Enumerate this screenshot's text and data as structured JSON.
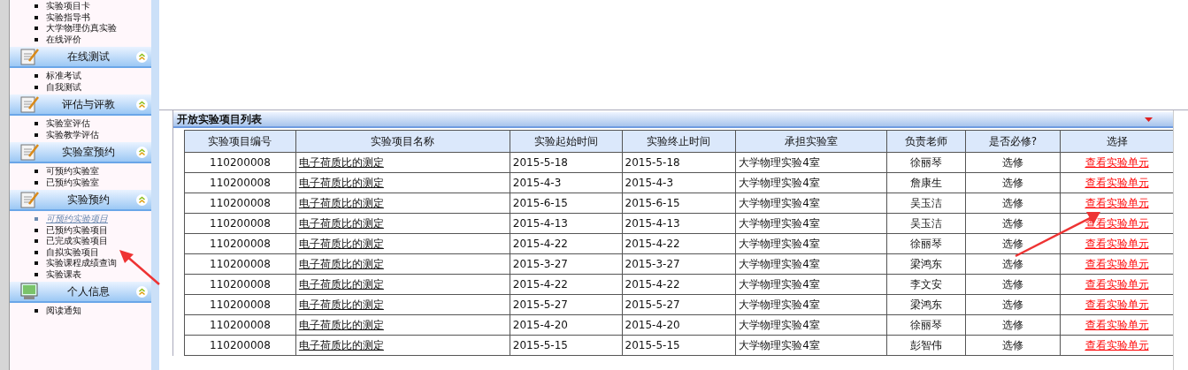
{
  "sidebar": {
    "sections": [
      {
        "items": [
          {
            "label": "实验项目卡",
            "selected": false
          },
          {
            "label": "实验指导书",
            "selected": false
          },
          {
            "label": "大学物理仿真实验",
            "selected": false
          },
          {
            "label": "在线评价",
            "selected": false
          }
        ]
      },
      {
        "title": "在线测试",
        "kind": "notepad",
        "items": [
          {
            "label": "标准考试",
            "selected": false
          },
          {
            "label": "自我测试",
            "selected": false
          }
        ]
      },
      {
        "title": "评估与评教",
        "kind": "notepad",
        "items": [
          {
            "label": "实验室评估",
            "selected": false
          },
          {
            "label": "实验教学评估",
            "selected": false
          }
        ]
      },
      {
        "title": "实验室预约",
        "kind": "notepad",
        "items": [
          {
            "label": "可预约实验室",
            "selected": false
          },
          {
            "label": "已预约实验室",
            "selected": false
          }
        ]
      },
      {
        "title": "实验预约",
        "kind": "notepad",
        "items": [
          {
            "label": "可预约实验项目",
            "selected": true
          },
          {
            "label": "已预约实验项目",
            "selected": false
          },
          {
            "label": "已完成实验项目",
            "selected": false
          },
          {
            "label": "自拟实验项目",
            "selected": false
          },
          {
            "label": "实验课程成绩查询",
            "selected": false
          },
          {
            "label": "实验课表",
            "selected": false
          }
        ]
      },
      {
        "title": "个人信息",
        "kind": "monitor",
        "items": [
          {
            "label": "阅读通知",
            "selected": false
          }
        ]
      }
    ]
  },
  "panel": {
    "title": "开放实验项目列表"
  },
  "table": {
    "columns": [
      "实验项目编号",
      "实验项目名称",
      "实验起始时间",
      "实验终止时间",
      "承担实验室",
      "负责老师",
      "是否必修?",
      "选择"
    ],
    "rows": [
      {
        "id": "110200008",
        "name": "电子荷质比的测定",
        "start": "2015-5-18",
        "end": "2015-5-18",
        "lab": "大学物理实验4室",
        "teacher": "徐丽琴",
        "required": "选修",
        "action": "查看实验单元"
      },
      {
        "id": "110200008",
        "name": "电子荷质比的测定",
        "start": "2015-4-3",
        "end": "2015-4-3",
        "lab": "大学物理实验4室",
        "teacher": "詹康生",
        "required": "选修",
        "action": "查看实验单元"
      },
      {
        "id": "110200008",
        "name": "电子荷质比的测定",
        "start": "2015-6-15",
        "end": "2015-6-15",
        "lab": "大学物理实验4室",
        "teacher": "吴玉洁",
        "required": "选修",
        "action": "查看实验单元"
      },
      {
        "id": "110200008",
        "name": "电子荷质比的测定",
        "start": "2015-4-13",
        "end": "2015-4-13",
        "lab": "大学物理实验4室",
        "teacher": "吴玉洁",
        "required": "选修",
        "action": "查看实验单元"
      },
      {
        "id": "110200008",
        "name": "电子荷质比的测定",
        "start": "2015-4-22",
        "end": "2015-4-22",
        "lab": "大学物理实验4室",
        "teacher": "徐丽琴",
        "required": "选修",
        "action": "查看实验单元"
      },
      {
        "id": "110200008",
        "name": "电子荷质比的测定",
        "start": "2015-3-27",
        "end": "2015-3-27",
        "lab": "大学物理实验4室",
        "teacher": "梁鸿东",
        "required": "选修",
        "action": "查看实验单元"
      },
      {
        "id": "110200008",
        "name": "电子荷质比的测定",
        "start": "2015-4-22",
        "end": "2015-4-22",
        "lab": "大学物理实验4室",
        "teacher": "李文安",
        "required": "选修",
        "action": "查看实验单元"
      },
      {
        "id": "110200008",
        "name": "电子荷质比的测定",
        "start": "2015-5-27",
        "end": "2015-5-27",
        "lab": "大学物理实验4室",
        "teacher": "梁鸿东",
        "required": "选修",
        "action": "查看实验单元"
      },
      {
        "id": "110200008",
        "name": "电子荷质比的测定",
        "start": "2015-4-20",
        "end": "2015-4-20",
        "lab": "大学物理实验4室",
        "teacher": "徐丽琴",
        "required": "选修",
        "action": "查看实验单元"
      },
      {
        "id": "110200008",
        "name": "电子荷质比的测定",
        "start": "2015-5-15",
        "end": "2015-5-15",
        "lab": "大学物理实验4室",
        "teacher": "彭智伟",
        "required": "选修",
        "action": "查看实验单元"
      }
    ]
  },
  "annotations": [
    {
      "kind": "arrow"
    },
    {
      "kind": "arrow"
    }
  ]
}
